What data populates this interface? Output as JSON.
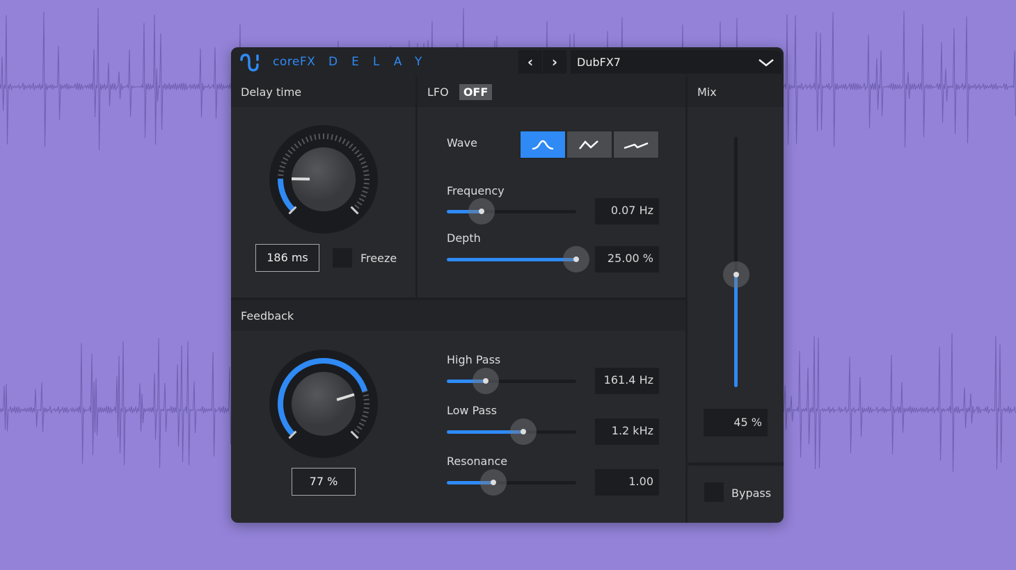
{
  "header": {
    "brand": "coreFX",
    "title": "DELAY",
    "prev_icon": "chevron-left",
    "next_icon": "chevron-right",
    "preset": "DubFX7",
    "dropdown_icon": "chevron-down"
  },
  "delay_time": {
    "title": "Delay time",
    "value": "186 ms",
    "knob_fraction": 0.17,
    "freeze_label": "Freeze",
    "freeze_checked": false
  },
  "lfo": {
    "title": "LFO",
    "state": "OFF",
    "wave_label": "Wave",
    "waves": [
      "sine",
      "triangle",
      "sawtooth"
    ],
    "selected_wave": 0,
    "frequency": {
      "label": "Frequency",
      "value": "0.07 Hz",
      "fraction": 0.27
    },
    "depth": {
      "label": "Depth",
      "value": "25.00 %",
      "fraction": 1.0
    }
  },
  "mix": {
    "title": "Mix",
    "value": "45 %",
    "fraction": 0.45,
    "bypass_label": "Bypass",
    "bypass_checked": false
  },
  "feedback": {
    "title": "Feedback",
    "value": "77 %",
    "knob_fraction": 0.77,
    "high_pass": {
      "label": "High Pass",
      "value": "161.4 Hz",
      "fraction": 0.3
    },
    "low_pass": {
      "label": "Low Pass",
      "value": "1.2 kHz",
      "fraction": 0.59
    },
    "resonance": {
      "label": "Resonance",
      "value": "1.00",
      "fraction": 0.36
    }
  },
  "colors": {
    "accent": "#2f8af5",
    "background": "#9382d8",
    "panel": "#27292d"
  }
}
